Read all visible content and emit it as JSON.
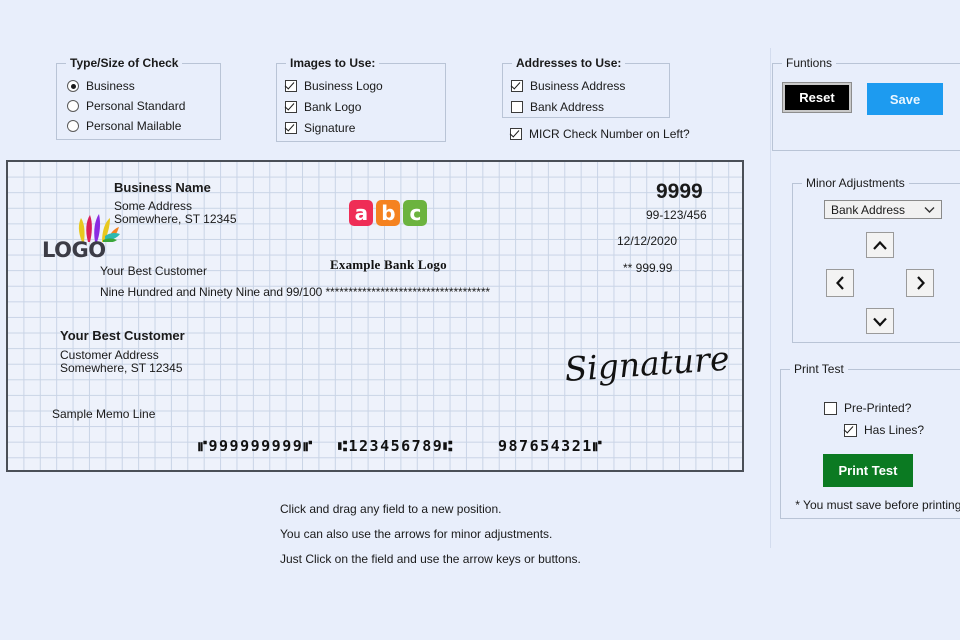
{
  "app": {
    "background_color": "#e8eefb"
  },
  "type_group": {
    "legend": "Type/Size of Check",
    "options": [
      {
        "label": "Business",
        "selected": true
      },
      {
        "label": "Personal Standard",
        "selected": false
      },
      {
        "label": "Personal Mailable",
        "selected": false
      }
    ]
  },
  "images_group": {
    "legend": "Images to Use:",
    "options": [
      {
        "label": "Business Logo",
        "checked": true
      },
      {
        "label": "Bank Logo",
        "checked": true
      },
      {
        "label": "Signature",
        "checked": true
      }
    ]
  },
  "addresses_group": {
    "legend": "Addresses to Use:",
    "options": [
      {
        "label": "Business Address",
        "checked": true
      },
      {
        "label": "Bank Address",
        "checked": false
      }
    ],
    "micr_option": {
      "label": "MICR Check Number on Left?",
      "checked": true
    }
  },
  "functions_group": {
    "legend": "Funtions",
    "reset_label": "Reset",
    "save_label": "Save",
    "reset_color": "#000000",
    "save_color": "#1d9bf0"
  },
  "minor_adjustments": {
    "legend": "Minor Adjustments",
    "selected_field": "Bank Address",
    "options": [
      "Bank Address"
    ],
    "up_label": "Up",
    "down_label": "Down",
    "left_label": "Left",
    "right_label": "Right"
  },
  "print_test": {
    "legend": "Print Test",
    "options": [
      {
        "label": "Pre-Printed?",
        "checked": false
      },
      {
        "label": "Has Lines?",
        "checked": true
      }
    ],
    "button_label": "Print Test",
    "button_color": "#0b7a22",
    "footnote": "* You must save before printing."
  },
  "check": {
    "business_logo": {
      "word": "LOGO"
    },
    "business_name": "Business Name",
    "business_address_line1": "Some Address",
    "business_address_line2": "Somewhere, ST 12345",
    "bank_logo": {
      "letters": [
        {
          "char": "a",
          "color": "#ef2d56"
        },
        {
          "char": "b",
          "color": "#f58220"
        },
        {
          "char": "c",
          "color": "#6cb33f"
        }
      ],
      "name": "Example Bank Logo"
    },
    "check_number": "9999",
    "fraction": "99-123/456",
    "date": "12/12/2020",
    "amount_numeric": "** 999.99",
    "payee": "Your Best Customer",
    "amount_words": "Nine Hundred and Ninety Nine and 99/100 ************************************",
    "customer_name": "Your Best Customer",
    "customer_address_line1": "Customer Address",
    "customer_address_line2": "Somewhere, ST 12345",
    "memo": "Sample Memo Line",
    "signature": "Signature",
    "micr_routing": "⑈999999999⑈",
    "micr_account": "⑆123456789⑆",
    "micr_number": "987654321⑈"
  },
  "hints": [
    "Click and drag any field to a new position.",
    "You can also use the arrows for minor adjustments.",
    "Just Click on the field and use the arrow keys or buttons."
  ]
}
